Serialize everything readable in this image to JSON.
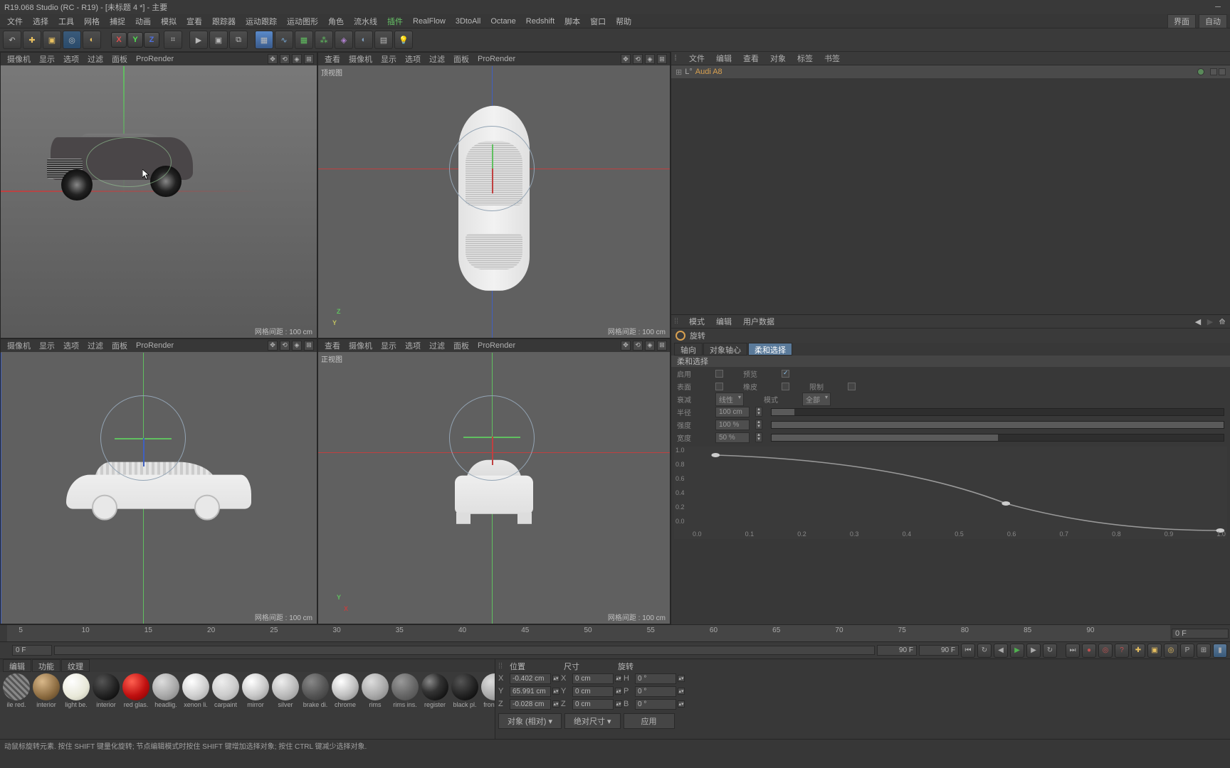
{
  "title": "R19.068 Studio (RC - R19) - [未标题 4 *] - 主要",
  "menu": [
    "文件",
    "选择",
    "工具",
    "网格",
    "捕捉",
    "动画",
    "模拟",
    "宣看",
    "跟踪器",
    "运动跟踪",
    "运动图形",
    "角色",
    "流水线",
    "插件",
    "RealFlow",
    "3DtoAll",
    "Octane",
    "Redshift",
    "脚本",
    "窗口",
    "帮助"
  ],
  "menu_hl_idx": 13,
  "menu_right": {
    "interface": "界面",
    "auto": "自动"
  },
  "viewport_menu": [
    "查看",
    "摄像机",
    "显示",
    "选项",
    "过滤",
    "面板",
    "ProRender"
  ],
  "viewport_menu_short": [
    "摄像机",
    "显示",
    "选项",
    "过滤",
    "面板",
    "ProRender"
  ],
  "vp_labels": {
    "top": "顶视图",
    "front": "正视图"
  },
  "grid": "网格间距 : 100 cm",
  "obj_tabs": [
    "文件",
    "编辑",
    "查看",
    "对象",
    "标签",
    "书签"
  ],
  "object_name": "Audi A8",
  "attr_head": [
    "模式",
    "编辑",
    "用户数据"
  ],
  "rot_title": "旋转",
  "attr_tabs": [
    "轴向",
    "对象轴心",
    "柔和选择"
  ],
  "attr_section": "柔和选择",
  "fields": {
    "enable": "启用",
    "preview": "预览",
    "surface": "表面",
    "rubber": "橡皮",
    "limit": "限制",
    "falloff": "衰减",
    "falloff_val": "线性",
    "mode": "模式",
    "mode_val": "全部",
    "radius": "半径",
    "radius_val": "100 cm",
    "strength": "强度",
    "strength_val": "100 %",
    "width": "宽度",
    "width_val": "50 %"
  },
  "curve_y": [
    "1.0",
    "0.8",
    "0.6",
    "0.4",
    "0.2",
    "0.0"
  ],
  "curve_x": [
    "0.0",
    "0.1",
    "0.2",
    "0.3",
    "0.4",
    "0.5",
    "0.6",
    "0.7",
    "0.8",
    "0.9",
    "1.0"
  ],
  "timeline": {
    "ticks": [
      5,
      10,
      15,
      20,
      25,
      30,
      35,
      40,
      45,
      50,
      55,
      60,
      65,
      70,
      75,
      80,
      85,
      90
    ],
    "cur": "0 F"
  },
  "timectrl": {
    "start": "0 F",
    "end": "90 F",
    "field": "90 F"
  },
  "mat_tabs": [
    "编辑",
    "功能",
    "纹理"
  ],
  "materials": [
    {
      "name": "ile red.",
      "bg": "repeating-linear-gradient(45deg,#888,#888 3px,#555 3px,#555 6px)"
    },
    {
      "name": "interior",
      "bg": "radial-gradient(circle at 35% 30%,#d9b88a,#8a6a3f 60%,#4a3820)"
    },
    {
      "name": "light be.",
      "bg": "radial-gradient(circle at 35% 30%,#fff,#e8e8d8 60%,#b5b5a5)"
    },
    {
      "name": "interior",
      "bg": "radial-gradient(circle at 35% 30%,#555,#222 55%,#000)"
    },
    {
      "name": "red glas.",
      "bg": "radial-gradient(circle at 35% 30%,#ff6050,#c01010 55%,#700)"
    },
    {
      "name": "headlig.",
      "bg": "radial-gradient(circle at 35% 30%,#ddd,#aaa 55%,#777)"
    },
    {
      "name": "xenon li.",
      "bg": "radial-gradient(circle at 35% 30%,#fff,#d0d0d0 55%,#999)"
    },
    {
      "name": "carpaint",
      "bg": "radial-gradient(circle at 35% 30%,#eee,#ccc 55%,#999)"
    },
    {
      "name": "mirror",
      "bg": "radial-gradient(circle at 35% 30%,#fff,#c8c8c8 55%,#888)"
    },
    {
      "name": "silver",
      "bg": "radial-gradient(circle at 35% 30%,#eee,#bbb 55%,#888)"
    },
    {
      "name": "brake di.",
      "bg": "radial-gradient(circle at 35% 30%,#888,#555 55%,#333)"
    },
    {
      "name": "chrome",
      "bg": "radial-gradient(circle at 35% 30%,#fff,#c0c0c0 55%,#777)"
    },
    {
      "name": "rims",
      "bg": "radial-gradient(circle at 35% 30%,#ddd,#aaa 55%,#777)"
    },
    {
      "name": "rims ins.",
      "bg": "radial-gradient(circle at 35% 30%,#999,#666 55%,#444)"
    },
    {
      "name": "register",
      "bg": "radial-gradient(circle at 30% 30%,#888,#333 40%,#000),repeating-linear-gradient(90deg,#fff,#fff 1px,transparent 1px,transparent 3px)"
    },
    {
      "name": "black pl.",
      "bg": "radial-gradient(circle at 35% 30%,#555,#222 55%,#000)"
    },
    {
      "name": "front wi.",
      "bg": "radial-gradient(circle at 35% 30%,#ddd,#aaa 55%,#777)"
    }
  ],
  "coord_head": [
    "位置",
    "尺寸",
    "旋转"
  ],
  "coord": {
    "pos": {
      "X": "-0.402 cm",
      "Y": "65.991 cm",
      "Z": "-0.028 cm"
    },
    "size": {
      "X": "0 cm",
      "Y": "0 cm",
      "Z": "0 cm"
    },
    "rot": {
      "H": "0 °",
      "P": "0 °",
      "B": "0 °"
    }
  },
  "coord_btns": {
    "abs": "对象 (相对)",
    "abs2": "绝对尺寸",
    "apply": "应用"
  },
  "status": "动鼠标旋转元素. 按住 SHIFT 键量化旋转; 节点编辑模式时按住 SHIFT 键增加选择对象; 按住 CTRL 键减少选择对象."
}
